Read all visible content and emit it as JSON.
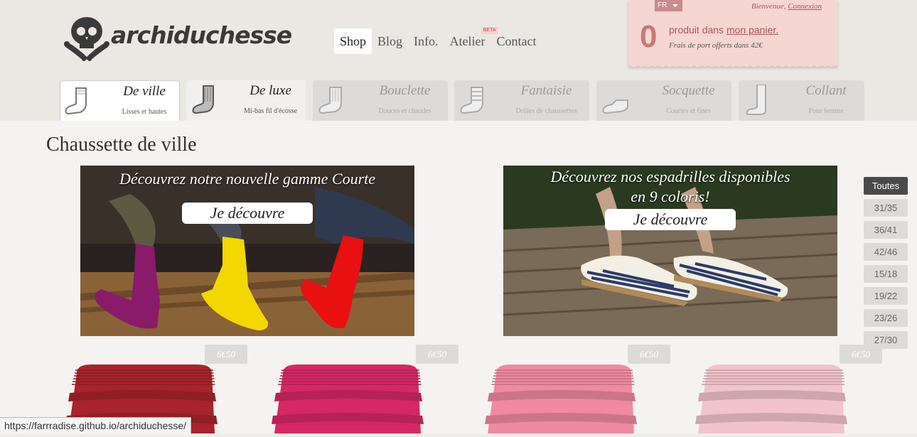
{
  "brand": {
    "name": "archiduchesse"
  },
  "nav": [
    {
      "label": "Shop",
      "active": true
    },
    {
      "label": "Blog"
    },
    {
      "label": "Info."
    },
    {
      "label": "Atelier",
      "badge": "BETA"
    },
    {
      "label": "Contact"
    }
  ],
  "cart": {
    "language": "FR",
    "welcome": "Bienvenue,",
    "login": "Connexion",
    "count": "0",
    "text": "produit dans",
    "link": "mon panier.",
    "shipping": "Frais de port offerts dans 42€"
  },
  "categories": [
    {
      "name": "De ville",
      "sub": "Lisses et hautes"
    },
    {
      "name": "De luxe",
      "sub": "Mi-bas fil d'écosse"
    },
    {
      "name": "Bouclette",
      "sub": "Douces et chaudes"
    },
    {
      "name": "Fantaisie",
      "sub": "Drôles de chaussettes"
    },
    {
      "name": "Socquette",
      "sub": "Courtes et fines"
    },
    {
      "name": "Collant",
      "sub": "Pour femme"
    }
  ],
  "page_title": "Chaussette de ville",
  "banners": [
    {
      "caption": "Découvrez notre nouvelle gamme Courte",
      "button": "Je découvre"
    },
    {
      "caption_line1": "Découvrez nos espadrilles disponibles",
      "caption_line2": "en 9 coloris!",
      "button": "Je découvre"
    }
  ],
  "sizes": [
    "Toutes",
    "31/35",
    "36/41",
    "42/46",
    "15/18",
    "19/22",
    "23/26",
    "27/30"
  ],
  "products": [
    {
      "price": "6€50",
      "color": "#a8232b"
    },
    {
      "price": "6€50",
      "color": "#d52864"
    },
    {
      "price": "6€50",
      "color": "#f08aa0"
    },
    {
      "price": "6€50",
      "color": "#f2c3cb"
    }
  ],
  "status_url": "https://farrradise.github.io/archiduchesse/",
  "colors": {
    "accent": "#c97878",
    "cart_bg": "#f5d6d2",
    "tab_bg": "#dcdbd9"
  }
}
